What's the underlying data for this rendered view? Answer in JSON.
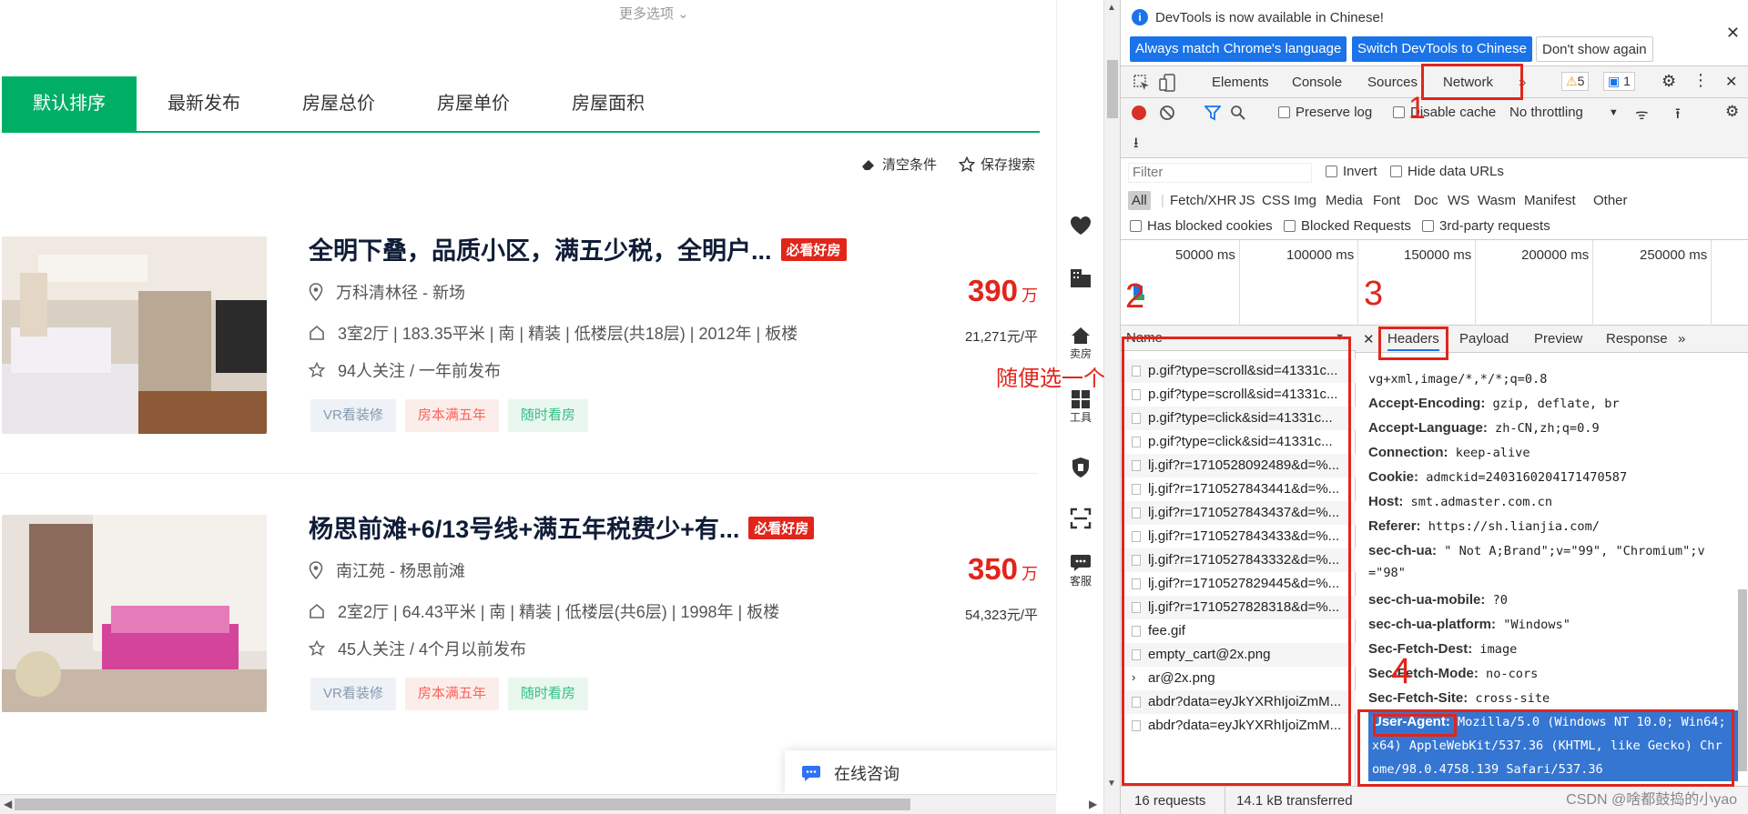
{
  "page": {
    "more_options": "更多选项",
    "sort_tabs": [
      "默认排序",
      "最新发布",
      "房屋总价",
      "房屋单价",
      "房屋面积"
    ],
    "clear_conditions": "清空条件",
    "save_search": "保存搜索",
    "listings": [
      {
        "title": "全明下叠，品质小区，满五少税，全明户...",
        "badge": "必看好房",
        "location": "万科清林径 - 新场",
        "info": "3室2厅 | 183.35平米 | 南 | 精装 | 低楼层(共18层) | 2012年 | 板楼",
        "follow": "94人关注 / 一年前发布",
        "tags": [
          "VR看装修",
          "房本满五年",
          "随时看房"
        ],
        "price": "390",
        "price_unit": "万",
        "unit_price": "21,271元/平"
      },
      {
        "title": "杨思前滩+6/13号线+满五年税费少+有...",
        "badge": "必看好房",
        "location": "南江苑 - 杨思前滩",
        "info": "2室2厅 | 64.43平米 | 南 | 精装 | 低楼层(共6层) | 1998年 | 板楼",
        "follow": "45人关注 / 4个月以前发布",
        "tags": [
          "VR看装修",
          "房本满五年",
          "随时看房"
        ],
        "price": "350",
        "price_unit": "万",
        "unit_price": "54,323元/平"
      }
    ],
    "consult": "在线咨询",
    "rail": {
      "sell": "卖房",
      "tools": "工具",
      "service": "客服"
    }
  },
  "devtools": {
    "info_msg": "DevTools is now available in Chinese!",
    "btn_match": "Always match Chrome's language",
    "btn_switch": "Switch DevTools to Chinese",
    "btn_dont": "Don't show again",
    "tabs": [
      "Elements",
      "Console",
      "Sources",
      "Network"
    ],
    "warn_count": "5",
    "msg_count": "1",
    "preserve_log": "Preserve log",
    "disable_cache": "Disable cache",
    "throttling": "No throttling",
    "filter_placeholder": "Filter",
    "invert": "Invert",
    "hide_data_urls": "Hide data URLs",
    "types": [
      "All",
      "Fetch/XHR",
      "JS",
      "CSS",
      "Img",
      "Media",
      "Font",
      "Doc",
      "WS",
      "Wasm",
      "Manifest",
      "Other"
    ],
    "has_blocked_cookies": "Has blocked cookies",
    "blocked_requests": "Blocked Requests",
    "third_party": "3rd-party requests",
    "ticks": [
      "50000 ms",
      "100000 ms",
      "150000 ms",
      "200000 ms",
      "250000 ms"
    ],
    "name_header": "Name",
    "requests": [
      "p.gif?type=scroll&sid=41331c...",
      "p.gif?type=scroll&sid=41331c...",
      "p.gif?type=click&sid=41331c...",
      "p.gif?type=click&sid=41331c...",
      "lj.gif?r=1710528092489&d=%...",
      "lj.gif?r=1710527843441&d=%...",
      "lj.gif?r=1710527843437&d=%...",
      "lj.gif?r=1710527843433&d=%...",
      "lj.gif?r=1710527843332&d=%...",
      "lj.gif?r=1710527829445&d=%...",
      "lj.gif?r=1710527828318&d=%...",
      "fee.gif",
      "empty_cart@2x.png",
      "ar@2x.png",
      "abdr?data=eyJkYXRhIjoiZmM...",
      "abdr?data=eyJkYXRhIjoiZmM..."
    ],
    "subtabs": [
      "Headers",
      "Payload",
      "Preview",
      "Response"
    ],
    "headers": [
      {
        "k": "",
        "v": "vg+xml,image/*,*/*;q=0.8"
      },
      {
        "k": "Accept-Encoding:",
        "v": "gzip, deflate, br"
      },
      {
        "k": "Accept-Language:",
        "v": "zh-CN,zh;q=0.9"
      },
      {
        "k": "Connection:",
        "v": "keep-alive"
      },
      {
        "k": "Cookie:",
        "v": "admckid=2403160204171470587"
      },
      {
        "k": "Host:",
        "v": "smt.admaster.com.cn"
      },
      {
        "k": "Referer:",
        "v": "https://sh.lianjia.com/"
      },
      {
        "k": "sec-ch-ua:",
        "v": "\" Not A;Brand\";v=\"99\", \"Chromium\";v"
      },
      {
        "k": "",
        "v": "=\"98\""
      },
      {
        "k": "sec-ch-ua-mobile:",
        "v": "?0"
      },
      {
        "k": "sec-ch-ua-platform:",
        "v": "\"Windows\""
      },
      {
        "k": "Sec-Fetch-Dest:",
        "v": "image"
      },
      {
        "k": "Sec-Fetch-Mode:",
        "v": "no-cors"
      },
      {
        "k": "Sec-Fetch-Site:",
        "v": "cross-site"
      }
    ],
    "ua_key": "User-Agent:",
    "ua_line1": "Mozilla/5.0 (Windows NT 10.0; Win64;",
    "ua_line2": "x64) AppleWebKit/537.36 (KHTML, like Gecko) Chr",
    "ua_line3": "ome/98.0.4758.139 Safari/537.36",
    "status_requests": "16 requests",
    "status_transferred": "14.1 kB transferred"
  },
  "annotations": {
    "n1": "1",
    "n2": "2",
    "n3": "3",
    "n4": "4",
    "pick_any": "随便选一个"
  },
  "watermark": "CSDN @啥都鼓捣的小yao",
  "colors": {
    "accent": "#00ae66",
    "price": "#e1251b",
    "annotation": "#e1251b",
    "selection": "#3476d2"
  }
}
